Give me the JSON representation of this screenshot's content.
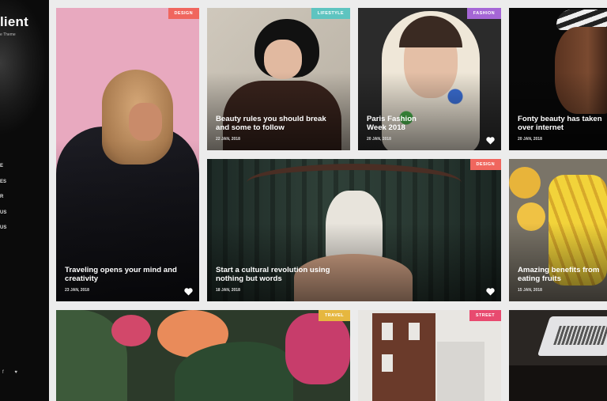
{
  "sidebar": {
    "logo": "lient",
    "tagline": "e Theme",
    "nav": [
      "E",
      "ES",
      "R",
      "US",
      "US"
    ],
    "social": "f  ♥"
  },
  "colors": {
    "design": "#f0665e",
    "lifestyle": "#5ec4c0",
    "fashion": "#a566d6",
    "travel": "#e6b73f",
    "street": "#e84a6f"
  },
  "cards": [
    {
      "tag": "",
      "title": "",
      "date": ""
    },
    {
      "tag": "Design",
      "title": "Traveling opens your mind and creativity",
      "date": "23 JAN, 2018"
    },
    {
      "tag": "Lifestyle",
      "title": "Beauty rules you should break and some to follow",
      "date": "22 JAN, 2018"
    },
    {
      "tag": "Fashion",
      "title": "Paris Fashion Week 2018",
      "date": "20 JAN, 2018"
    },
    {
      "tag": "",
      "title": "Fonty beauty has taken over internet",
      "date": "20 JAN, 2018"
    },
    {
      "tag": "Design",
      "title": "Start a cultural revolution using nothing but words",
      "date": "18 JAN, 2018"
    },
    {
      "tag": "",
      "title": "Amazing benefits from eating fruits",
      "date": "15 JAN, 2018"
    },
    {
      "tag": "Travel",
      "title": "",
      "date": ""
    },
    {
      "tag": "Street",
      "title": "",
      "date": ""
    },
    {
      "tag": "",
      "title": "",
      "date": ""
    }
  ],
  "icons": {
    "heart": "heart-icon"
  }
}
